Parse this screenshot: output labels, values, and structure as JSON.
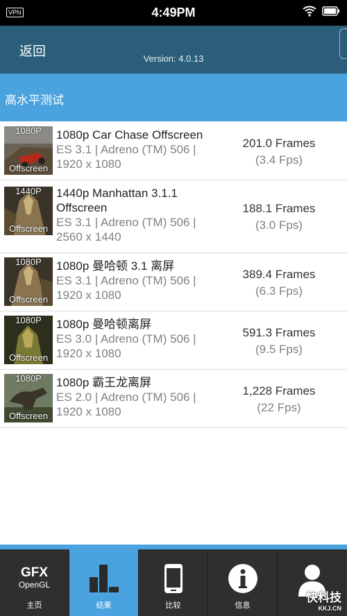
{
  "status_bar": {
    "vpn": "VPN",
    "time": "4:49PM"
  },
  "header": {
    "back_label": "返回",
    "version": "Version: 4.0.13"
  },
  "section_title": "高水平测试",
  "tests": [
    {
      "thumb_res": "1080P",
      "thumb_label": "Offscreen",
      "title": "1080p Car Chase Offscreen",
      "line1": "ES 3.1 | Adreno (TM) 506 |",
      "line2": "1920 x 1080",
      "frames": "201.0 Frames",
      "fps": "(3.4 Fps)",
      "thumb_color": "#9c3a22"
    },
    {
      "thumb_res": "1440P",
      "thumb_label": "Offscreen",
      "title_line1": "1440p Manhattan 3.1.1",
      "title_line2": "Offscreen",
      "line1": "ES 3.1 | Adreno (TM) 506 |",
      "line2": "2560 x 1440",
      "frames": "188.1 Frames",
      "fps": "(3.0 Fps)",
      "thumb_color": "#6b5a3a"
    },
    {
      "thumb_res": "1080P",
      "thumb_label": "Offscreen",
      "title": "1080p 曼哈顿 3.1 离屏",
      "line1": "ES 3.1 | Adreno (TM) 506 |",
      "line2": "1920 x 1080",
      "frames": "389.4 Frames",
      "fps": "(6.3 Fps)",
      "thumb_color": "#6b5a3a"
    },
    {
      "thumb_res": "1080P",
      "thumb_label": "Offscreen",
      "title": "1080p 曼哈顿离屏",
      "line1": "ES 3.0 | Adreno (TM) 506 |",
      "line2": "1920 x 1080",
      "frames": "591.3 Frames",
      "fps": "(9.5 Fps)",
      "thumb_color": "#6a6a2c"
    },
    {
      "thumb_res": "1080P",
      "thumb_label": "Offscreen",
      "title": "1080p 霸王龙离屏",
      "line1": "ES 2.0 | Adreno (TM) 506 |",
      "line2": "1920 x 1080",
      "frames": "1,228 Frames",
      "fps": "(22 Fps)",
      "thumb_color": "#4d5a3a"
    }
  ],
  "tabs": [
    {
      "label": "主页",
      "logo_line1": "GFX",
      "logo_line2": "OpenGL",
      "icon": "gfx-logo"
    },
    {
      "label": "结果",
      "icon": "bar-chart-icon",
      "active": true
    },
    {
      "label": "比较",
      "icon": "phone-icon"
    },
    {
      "label": "信息",
      "icon": "info-icon"
    },
    {
      "label": "",
      "icon": "user-icon"
    }
  ],
  "watermark": {
    "text": "快科技",
    "sub": "KKJ.CN"
  },
  "colors": {
    "header": "#2b5e7a",
    "accent": "#4aa3df",
    "tabbar": "#2f2f2f"
  }
}
